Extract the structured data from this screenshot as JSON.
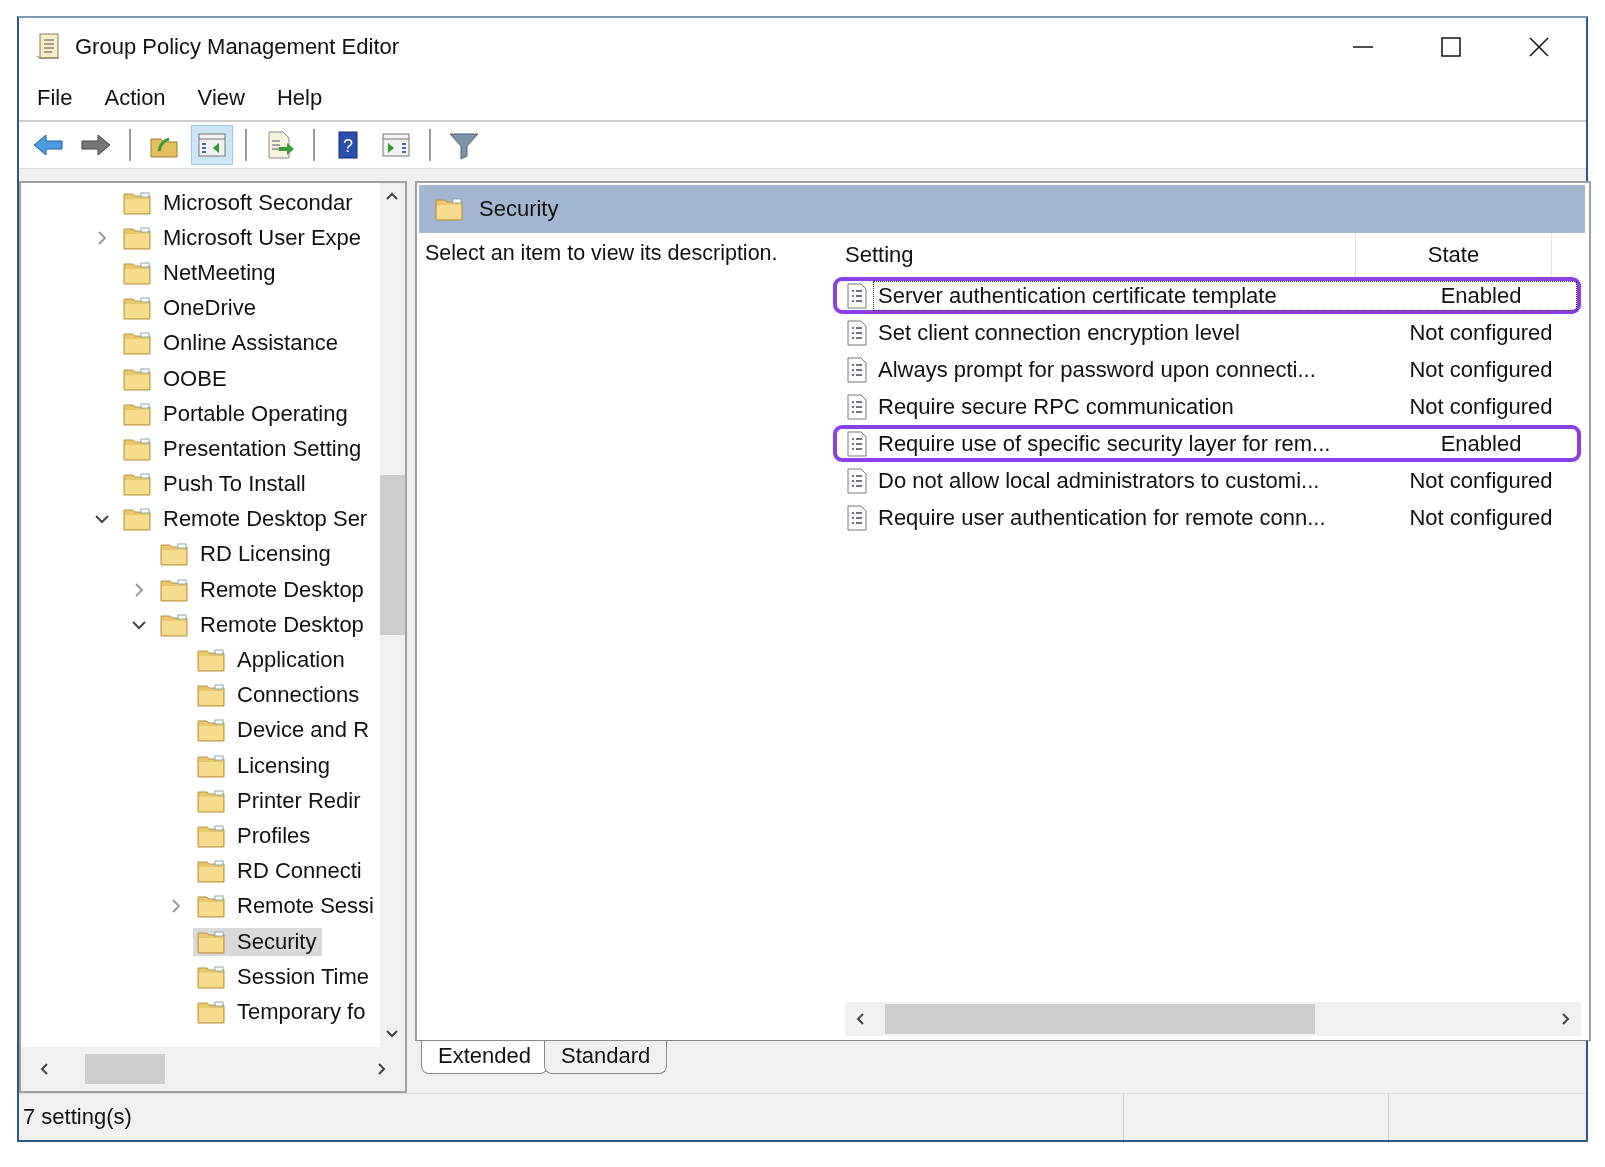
{
  "window": {
    "title": "Group Policy Management Editor"
  },
  "menu": [
    "File",
    "Action",
    "View",
    "Help"
  ],
  "toolbar": [
    {
      "kind": "back",
      "pressed": false
    },
    {
      "kind": "forward",
      "pressed": false
    },
    {
      "kind": "sep"
    },
    {
      "kind": "up",
      "pressed": false
    },
    {
      "kind": "tree",
      "pressed": true
    },
    {
      "kind": "sep"
    },
    {
      "kind": "export",
      "pressed": false
    },
    {
      "kind": "sep"
    },
    {
      "kind": "help",
      "pressed": false,
      "glyph": "?"
    },
    {
      "kind": "pane",
      "pressed": false
    },
    {
      "kind": "sep"
    },
    {
      "kind": "filter",
      "pressed": false
    }
  ],
  "tree": [
    {
      "label": "Microsoft Secondar",
      "selected": false
    },
    {
      "label": "Microsoft User Expe",
      "selected": false,
      "expanded": false
    },
    {
      "label": "NetMeeting",
      "selected": false
    },
    {
      "label": "OneDrive",
      "selected": false
    },
    {
      "label": "Online Assistance",
      "selected": false
    },
    {
      "label": "OOBE",
      "selected": false
    },
    {
      "label": "Portable Operating",
      "selected": false
    },
    {
      "label": "Presentation Setting",
      "selected": false
    },
    {
      "label": "Push To Install",
      "selected": false
    },
    {
      "label": "Remote Desktop Ser",
      "selected": false,
      "expanded": true,
      "children": [
        {
          "label": "RD Licensing",
          "selected": false
        },
        {
          "label": "Remote Desktop",
          "selected": false,
          "expanded": false
        },
        {
          "label": "Remote Desktop",
          "selected": false,
          "expanded": true,
          "children": [
            {
              "label": "Application",
              "selected": false
            },
            {
              "label": "Connections",
              "selected": false
            },
            {
              "label": "Device and R",
              "selected": false
            },
            {
              "label": "Licensing",
              "selected": false
            },
            {
              "label": "Printer Redir",
              "selected": false
            },
            {
              "label": "Profiles",
              "selected": false
            },
            {
              "label": "RD Connecti",
              "selected": false
            },
            {
              "label": "Remote Sessi",
              "selected": false,
              "expanded": false
            },
            {
              "label": "Security",
              "selected": true
            },
            {
              "label": "Session Time",
              "selected": false
            },
            {
              "label": "Temporary fo",
              "selected": false
            }
          ]
        }
      ]
    }
  ],
  "details": {
    "title": "Security",
    "description": "Select an item to view its description.",
    "columns": [
      "Setting",
      "State"
    ],
    "rows": [
      {
        "setting": "Server authentication certificate template",
        "state": "Enabled",
        "selected": true,
        "highlighted": true
      },
      {
        "setting": "Set client connection encryption level",
        "state": "Not configured",
        "selected": false,
        "highlighted": false
      },
      {
        "setting": "Always prompt for password upon connecti...",
        "state": "Not configured",
        "selected": false,
        "highlighted": false
      },
      {
        "setting": "Require secure RPC communication",
        "state": "Not configured",
        "selected": false,
        "highlighted": false
      },
      {
        "setting": "Require use of specific security layer for rem...",
        "state": "Enabled",
        "selected": false,
        "highlighted": true
      },
      {
        "setting": "Do not allow local administrators to customi...",
        "state": "Not configured",
        "selected": false,
        "highlighted": false
      },
      {
        "setting": "Require user authentication for remote conn...",
        "state": "Not configured",
        "selected": false,
        "highlighted": false
      }
    ]
  },
  "tabs": [
    {
      "label": "Extended",
      "selected": true
    },
    {
      "label": "Standard",
      "selected": false
    }
  ],
  "status_bar": "7 setting(s)"
}
